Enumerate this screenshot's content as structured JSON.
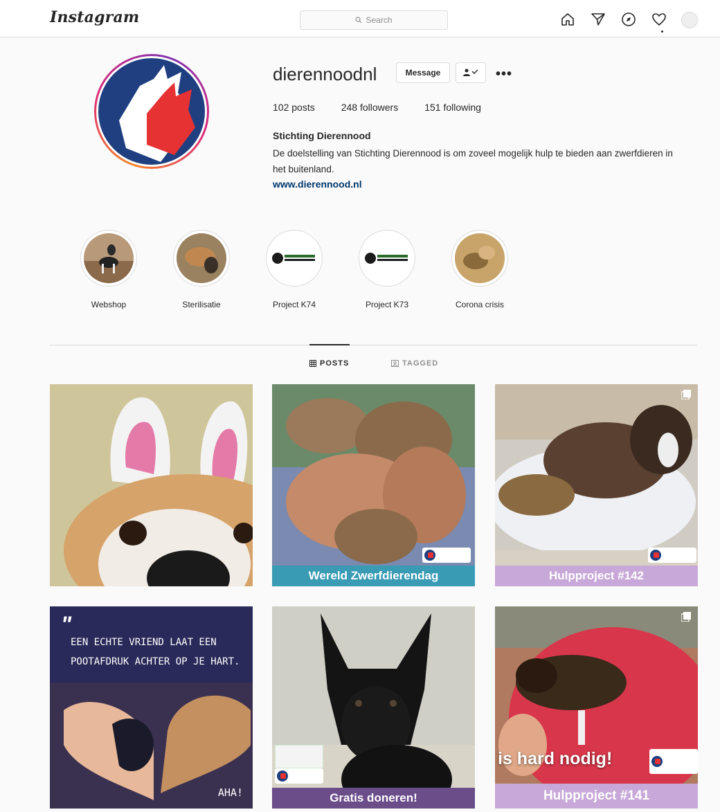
{
  "app": {
    "logo": "Instagram",
    "search_placeholder": "Search"
  },
  "nav": {
    "icons": [
      "home-icon",
      "direct-icon",
      "explore-icon",
      "activity-heart-icon",
      "profile-avatar"
    ]
  },
  "profile": {
    "username": "dierennoodnl",
    "message_button": "Message",
    "more": "•••",
    "stats": {
      "posts": "102 posts",
      "followers": "248 followers",
      "following": "151 following"
    },
    "full_name": "Stichting Dierennood",
    "bio": "De doelstelling van Stichting Dierennood is om zoveel mogelijk hulp te bieden aan zwerfdieren in het buitenland.",
    "website": "www.dierennood.nl"
  },
  "highlights": [
    {
      "label": "Webshop"
    },
    {
      "label": "Sterilisatie"
    },
    {
      "label": "Project K74"
    },
    {
      "label": "Project K73"
    },
    {
      "label": "Corona crisis"
    }
  ],
  "tabs": {
    "posts": "POSTS",
    "tagged": "TAGGED",
    "active": "posts"
  },
  "posts": [
    {
      "caption": ""
    },
    {
      "caption": "Wereld Zwerfdierendag"
    },
    {
      "caption": "Hulpproject #142"
    },
    {
      "caption": "",
      "quote": "Een echte vriend laat een pootafdruk achter op je hart.",
      "signature": "AHA!"
    },
    {
      "caption": "Gratis doneren!"
    },
    {
      "caption": "Hulpproject #141",
      "overlay": "is hard nodig!"
    }
  ],
  "colors": {
    "brand_blue": "#1f3f80",
    "brand_red": "#e63232",
    "caption_teal": "#3a9bb5",
    "caption_lilac": "#c8a8d8",
    "caption_purple": "#6b4d8a",
    "link": "#00376b"
  }
}
